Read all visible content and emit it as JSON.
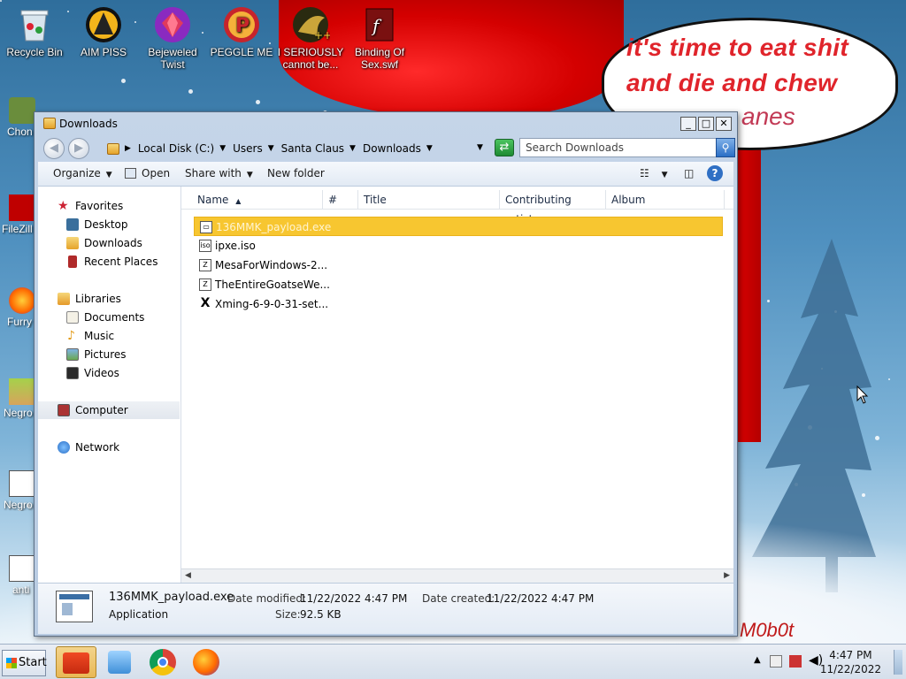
{
  "desktop": {
    "icons_top": [
      {
        "label": "Recycle Bin",
        "icon": "recycle-bin-icon"
      },
      {
        "label": "AIM PISS",
        "icon": "aim-icon"
      },
      {
        "label": "Bejeweled Twist",
        "icon": "bejeweled-icon"
      },
      {
        "label": "PEGGLE ME",
        "icon": "peggle-icon"
      },
      {
        "label": "I SERIOUSLY cannot be...",
        "icon": "app-icon"
      },
      {
        "label": "Binding Of Sex.swf",
        "icon": "flash-file-icon"
      }
    ],
    "icons_left": [
      {
        "label": "Chon",
        "icon": "chrome-icon"
      },
      {
        "label": "FileZill",
        "icon": "filezilla-icon"
      },
      {
        "label": "Furry",
        "icon": "firefox-icon"
      },
      {
        "label": "Negro",
        "icon": "house-icon"
      },
      {
        "label": "Negro",
        "icon": "document-icon"
      },
      {
        "label": "anti",
        "icon": "document-icon"
      }
    ],
    "wallpaper_bubble_text": "it's time to eat shit and die and chew",
    "wallpaper_bubble_text_2": "anes",
    "wallpaper_watermark": "M0b0t"
  },
  "window": {
    "title": "Downloads",
    "controls": {
      "minimize": "_",
      "maximize": "□",
      "close": "✕"
    },
    "address": {
      "crumbs": [
        "Local Disk (C:)",
        "Users",
        "Santa Claus",
        "Downloads"
      ]
    },
    "search_placeholder": "Search Downloads",
    "toolbar": {
      "organize": "Organize",
      "open": "Open",
      "share_with": "Share with",
      "new_folder": "New folder"
    },
    "nav": {
      "favorites": "Favorites",
      "desktop": "Desktop",
      "downloads": "Downloads",
      "recent_places": "Recent Places",
      "libraries": "Libraries",
      "documents": "Documents",
      "music": "Music",
      "pictures": "Pictures",
      "videos": "Videos",
      "computer": "Computer",
      "network": "Network"
    },
    "columns": {
      "name": "Name",
      "number": "#",
      "title": "Title",
      "contributing_artists": "Contributing artists",
      "album": "Album"
    },
    "files": [
      {
        "name": "136MMK_payload.exe",
        "icon": "exe-icon",
        "selected": true
      },
      {
        "name": "ipxe.iso",
        "icon": "iso-icon",
        "selected": false
      },
      {
        "name": "MesaForWindows-2...",
        "icon": "zip-icon",
        "selected": false
      },
      {
        "name": "TheEntireGoatseWe...",
        "icon": "zip-icon",
        "selected": false
      },
      {
        "name": "Xming-6-9-0-31-set...",
        "icon": "xming-icon",
        "selected": false
      }
    ],
    "details": {
      "filename": "136MMK_payload.exe",
      "type": "Application",
      "date_modified_label": "Date modified:",
      "date_modified": "11/22/2022 4:47 PM",
      "date_created_label": "Date created:",
      "date_created": "11/22/2022 4:47 PM",
      "size_label": "Size:",
      "size": "92.5 KB"
    }
  },
  "taskbar": {
    "start_label": "Start",
    "apps": [
      "explorer-icon",
      "media-player-icon",
      "chrome-icon",
      "firefox-icon"
    ],
    "clock_time": "4:47 PM",
    "clock_date": "11/22/2022"
  }
}
